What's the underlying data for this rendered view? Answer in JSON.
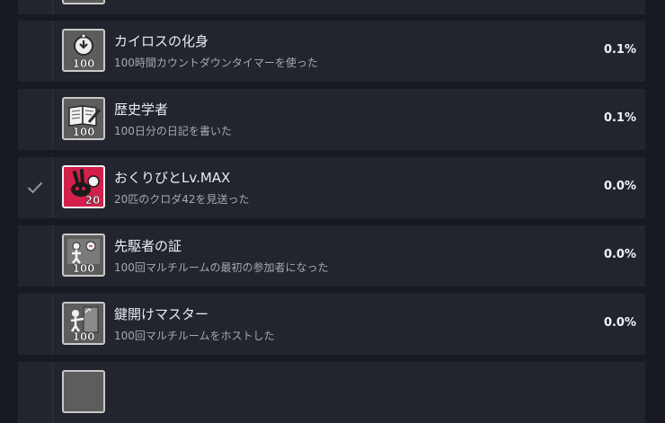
{
  "achievements": [
    {
      "title": "",
      "description": "",
      "percent": "",
      "unlocked": false,
      "icon": "partial-achievement-icon"
    },
    {
      "title": "カイロスの化身",
      "description": "100時間カウントダウンタイマーを使った",
      "percent": "0.1%",
      "unlocked": false,
      "icon": "stopwatch-100-icon",
      "badge": "100"
    },
    {
      "title": "歴史学者",
      "description": "100日分の日記を書いた",
      "percent": "0.1%",
      "unlocked": false,
      "icon": "diary-100-icon",
      "badge": "100"
    },
    {
      "title": "おくりびとLv.MAX",
      "description": "20匹のクロダ42を見送った",
      "percent": "0.0%",
      "unlocked": true,
      "icon": "rabbit-20-icon",
      "badge": "20"
    },
    {
      "title": "先駆者の証",
      "description": "100回マルチルームの最初の参加者になった",
      "percent": "0.0%",
      "unlocked": false,
      "icon": "pioneer-100-icon",
      "badge": "100"
    },
    {
      "title": "鍵開けマスター",
      "description": "100回マルチルームをホストした",
      "percent": "0.0%",
      "unlocked": false,
      "icon": "key-host-100-icon",
      "badge": "100"
    },
    {
      "title": "",
      "description": "",
      "percent": "",
      "unlocked": false,
      "icon": "partial-achievement-icon"
    }
  ],
  "colors": {
    "background": "#171a21",
    "row": "#22252e",
    "check": "#8f939b",
    "unlocked_icon": "#d2204a"
  }
}
